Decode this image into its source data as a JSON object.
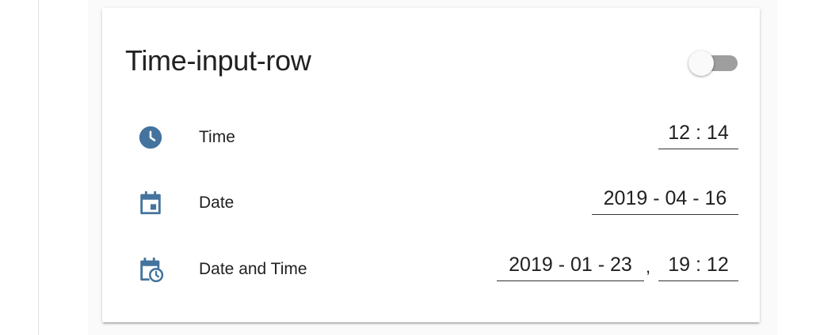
{
  "card": {
    "title": "Time-input-row",
    "toggle": {
      "state": "off"
    }
  },
  "rows": [
    {
      "icon": "clock-icon",
      "label": "Time",
      "time": "12 : 14"
    },
    {
      "icon": "calendar-icon",
      "label": "Date",
      "date": "2019 - 04 - 16"
    },
    {
      "icon": "calendar-clock-icon",
      "label": "Date and Time",
      "date": "2019 - 01 - 23",
      "separator": ",",
      "time": "19 : 12"
    }
  ],
  "colors": {
    "icon": "#44739e",
    "text": "#212121",
    "underline": "#333333",
    "toggle_track": "#9e9e9e",
    "toggle_thumb": "#fafafa"
  }
}
